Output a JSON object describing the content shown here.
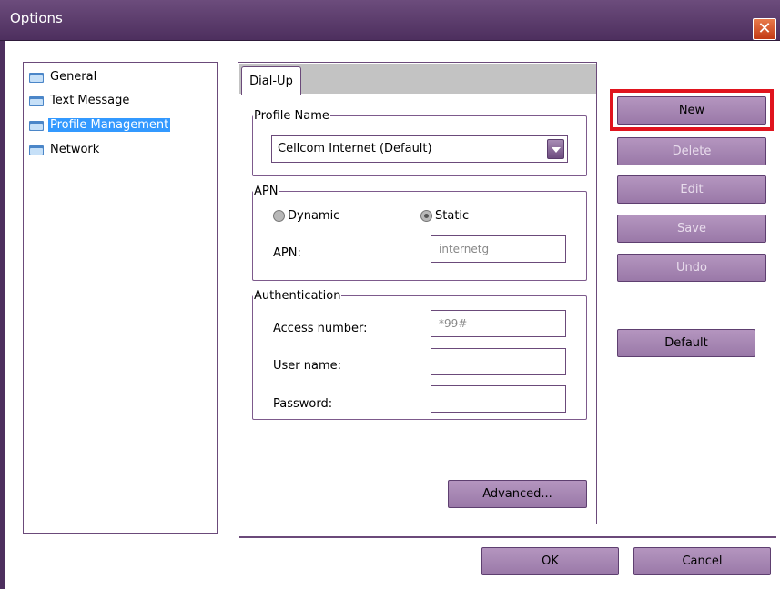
{
  "window": {
    "title": "Options",
    "close_glyph": "✕"
  },
  "tree": {
    "items": [
      {
        "label": "General",
        "selected": false
      },
      {
        "label": "Text Message",
        "selected": false
      },
      {
        "label": "Profile Management",
        "selected": true
      },
      {
        "label": "Network",
        "selected": false
      }
    ]
  },
  "tabs": [
    {
      "label": "Dial-Up",
      "active": true
    }
  ],
  "profile": {
    "legend": "Profile Name",
    "selected_value": "Cellcom Internet (Default)"
  },
  "apn": {
    "legend": "APN",
    "dynamic_label": "Dynamic",
    "static_label": "Static",
    "selected": "Static",
    "apn_label": "APN:",
    "apn_value": "internetg"
  },
  "auth": {
    "legend": "Authentication",
    "access_label": "Access number:",
    "access_value": "*99#",
    "user_label": "User name:",
    "user_value": "",
    "password_label": "Password:",
    "password_value": ""
  },
  "buttons": {
    "new": "New",
    "delete": "Delete",
    "edit": "Edit",
    "save": "Save",
    "undo": "Undo",
    "default": "Default",
    "advanced": "Advanced...",
    "ok": "OK",
    "cancel": "Cancel"
  },
  "colors": {
    "titlebar": "#4d2f5e",
    "button": "#a98bb6",
    "border": "#6b4a7a",
    "highlight": "#e0141e",
    "selection": "#3399ff"
  }
}
